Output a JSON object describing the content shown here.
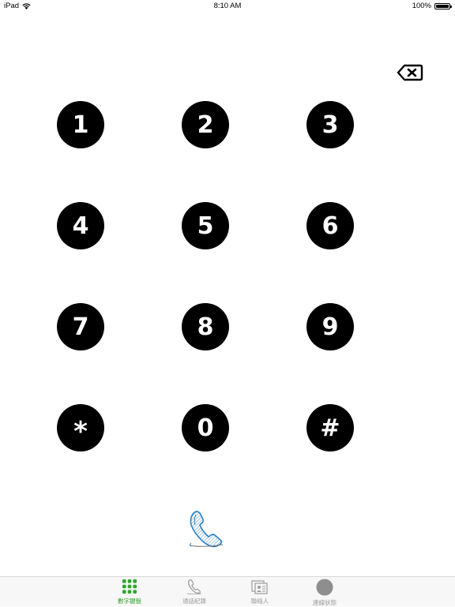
{
  "status_bar": {
    "device": "iPad",
    "time": "8:10 AM",
    "battery": "100%",
    "battery_level": 1.0
  },
  "keypad": {
    "keys": [
      "1",
      "2",
      "3",
      "4",
      "5",
      "6",
      "7",
      "8",
      "9",
      "*",
      "0",
      "#"
    ],
    "key_color": "#000000",
    "key_text_color": "#ffffff"
  },
  "icons": {
    "backspace": "backspace-icon",
    "call": "phone-handset-icon",
    "wifi": "wifi-icon"
  },
  "tab_bar": {
    "active_color": "#2fa52f",
    "inactive_color": "#9b9b9b",
    "tabs": [
      {
        "label": "數字鍵盤",
        "icon": "keypad-icon",
        "active": true
      },
      {
        "label": "通話紀錄",
        "icon": "call-history-icon",
        "active": false
      },
      {
        "label": "聯絡人",
        "icon": "contacts-icon",
        "active": false
      },
      {
        "label": "連線狀態",
        "icon": "connection-status-icon",
        "active": false
      }
    ]
  }
}
